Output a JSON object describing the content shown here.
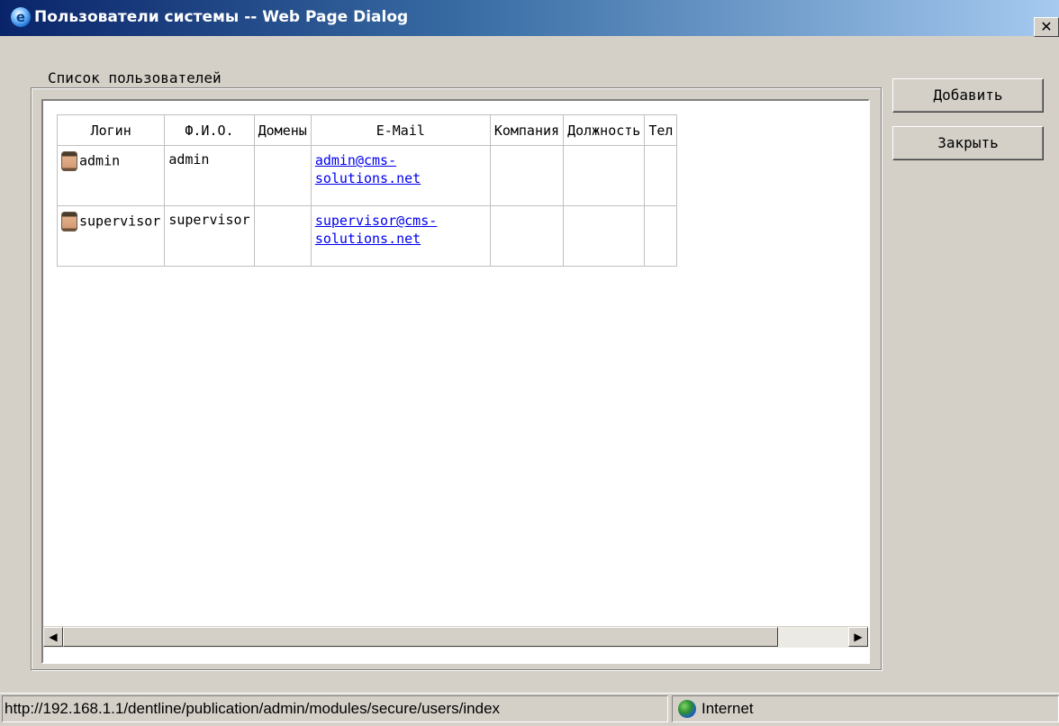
{
  "window": {
    "title": "Пользователи системы -- Web Page Dialog",
    "close_label": "✕"
  },
  "users_group": {
    "legend": "Список пользователей",
    "columns": [
      "Логин",
      "Ф.И.О.",
      "Домены",
      "E-Mail",
      "Компания",
      "Должность",
      "Тел"
    ],
    "rows": [
      {
        "login": "admin",
        "fio": "admin",
        "domains": "",
        "email": "admin@cms-solutions.net",
        "company": "",
        "position": "",
        "phone": "",
        "icon": "user-face-icon"
      },
      {
        "login": "supervisor",
        "fio": "supervisor",
        "domains": "",
        "email": "supervisor@cms-solutions.net",
        "company": "",
        "position": "",
        "phone": "",
        "icon": "user-face-icon"
      }
    ]
  },
  "buttons": {
    "add": "Добавить",
    "close": "Закрыть"
  },
  "scrollbar": {
    "left_arrow": "◀",
    "right_arrow": "▶"
  },
  "statusbar": {
    "url": "http://192.168.1.1/dentline/publication/admin/modules/secure/users/index",
    "zone": "Internet",
    "zone_icon": "globe-icon"
  }
}
